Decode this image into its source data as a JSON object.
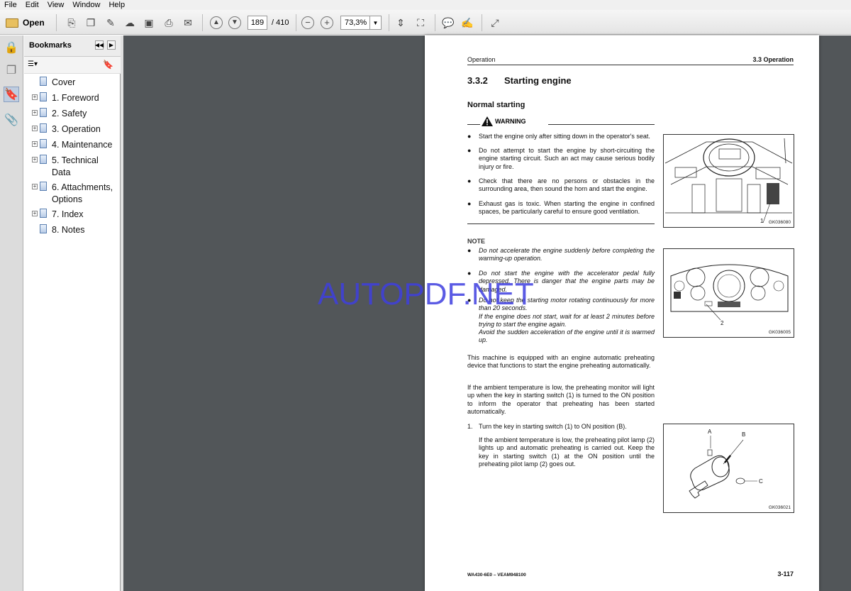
{
  "menu": [
    "File",
    "Edit",
    "View",
    "Window",
    "Help"
  ],
  "toolbar": {
    "open_label": "Open",
    "page_current": "189",
    "page_total": "/ 410",
    "zoom": "73,3%"
  },
  "bookmarks": {
    "title": "Bookmarks",
    "items": [
      {
        "label": "Cover",
        "expandable": false
      },
      {
        "label": "1. Foreword",
        "expandable": true
      },
      {
        "label": "2. Safety",
        "expandable": true
      },
      {
        "label": "3. Operation",
        "expandable": true
      },
      {
        "label": "4. Maintenance",
        "expandable": true
      },
      {
        "label": "5. Technical Data",
        "expandable": true
      },
      {
        "label": "6. Attachments, Options",
        "expandable": true
      },
      {
        "label": "7. Index",
        "expandable": true
      },
      {
        "label": "8. Notes",
        "expandable": false
      }
    ]
  },
  "page": {
    "header_left": "Operation",
    "header_right": "3.3  Operation",
    "section_number": "3.3.2",
    "section_title": "Starting engine",
    "subsection": "Normal starting",
    "warning_label": "WARNING",
    "warning_bullets": [
      "Start the engine only after sitting down in the operator's seat.",
      "Do not attempt to start the engine by short-circuiting the engine starting circuit. Such an act may cause serious bodily injury or fire.",
      "Check that there are no persons or obstacles in the surrounding area, then sound the horn and start the engine.",
      "Exhaust gas is toxic. When starting the engine in confined spaces, be particularly careful to ensure good ventilation."
    ],
    "note_label": "NOTE",
    "note_bullets": [
      "Do not accelerate the engine suddenly before completing the warming-up operation.",
      "Do not start the engine with the accelerator pedal fully depressed. There is danger that the engine parts may be damaged.",
      "Do not keep the starting motor rotating continuously for more than 20 seconds."
    ],
    "note_extra_1": "If the engine does not start, wait for at least 2 minutes before trying to start the engine again.",
    "note_extra_2": "Avoid the sudden acceleration of the engine until it is warmed up.",
    "para_1": "This machine is equipped with an engine automatic preheating device that functions to start the engine preheating automatically.",
    "para_2": "If the ambient temperature is low, the preheating monitor will light up when the key in starting switch (1) is turned to the ON position to inform the operator that preheating has been started automatically.",
    "step_1_number": "1.",
    "step_1": "Turn the key in starting switch (1) to ON position (B).",
    "step_1_detail": "If the ambient temperature is low, the preheating pilot lamp (2) lights up and automatic preheating is carried out. Keep the key in starting switch (1) at the ON position until the preheating pilot lamp (2) goes out.",
    "fig1_callout": "1",
    "fig1_code": "GK036080",
    "fig2_callout": "2",
    "fig2_code": "GK036005",
    "fig3_label_a": "A",
    "fig3_label_b": "B",
    "fig3_label_c": "C",
    "fig3_code": "GK036021",
    "footer_left": "WA430-6E0 – VEAM948100",
    "footer_right": "3-117"
  },
  "watermark": "AUTOPDF.NET"
}
